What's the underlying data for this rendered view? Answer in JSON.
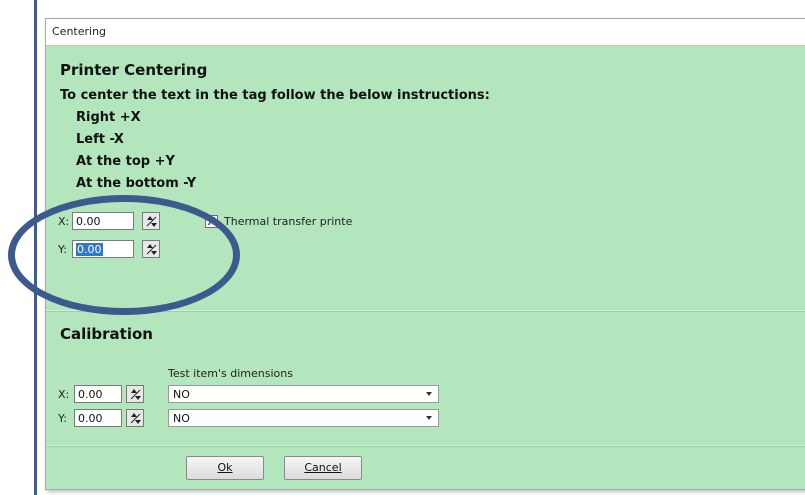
{
  "window": {
    "title": "Centering"
  },
  "centering": {
    "heading": "Printer Centering",
    "instructions": "To center the text in the tag follow the below instructions:",
    "lines": [
      "Right +X",
      "Left -X",
      "At the top +Y",
      "At the bottom -Y"
    ],
    "x_label": "X:",
    "x_value": "0.00",
    "y_label": "Y:",
    "y_value": "0.00",
    "thermal_checkbox": {
      "checked": true,
      "mark": "X",
      "label": "Thermal transfer printe"
    }
  },
  "calibration": {
    "heading": "Calibration",
    "dimensions_label": "Test item's dimensions",
    "x_label": "X:",
    "x_value": "0.00",
    "y_label": "Y:",
    "y_value": "0.00",
    "dropdown1": "NO",
    "dropdown2": "NO"
  },
  "buttons": {
    "ok_label": "Ok",
    "cancel_label": "Cancel"
  },
  "colors": {
    "panel_bg": "#b3e6bd",
    "annotation_circle": "#3b5a8e"
  },
  "annotation": {
    "shape": "ellipse",
    "highlights": "centering offset fields"
  }
}
